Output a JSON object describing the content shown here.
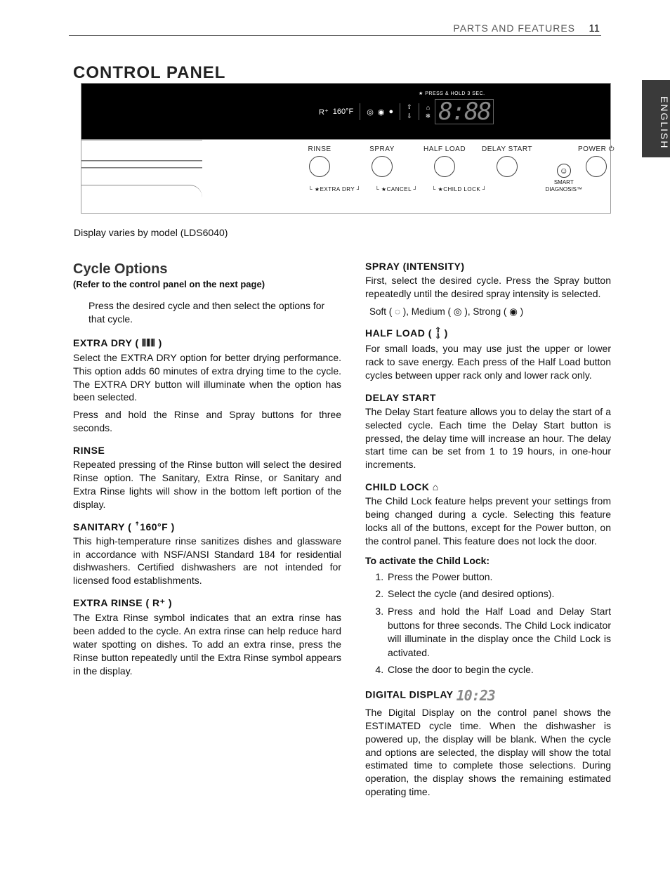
{
  "header": {
    "section": "PARTS AND FEATURES",
    "page": "11",
    "lang_tab": "ENGLISH"
  },
  "title": "CONTROL PANEL",
  "panel": {
    "press_hold": "PRESS & HOLD 3 SEC.",
    "display_icons": {
      "r": "R⁺",
      "temp": "160°F",
      "spray1": "◎",
      "spray2": "◉",
      "spray3": "●",
      "up": "⇧",
      "down": "⇩",
      "lock": "⌂",
      "snow": "❄"
    },
    "seg_display": "8:88",
    "buttons": {
      "rinse": "RINSE",
      "spray": "SPRAY",
      "half_load": "HALF LOAD",
      "delay_start": "DELAY START",
      "power": "POWER ⏻"
    },
    "under": {
      "extra_dry": "EXTRA DRY",
      "cancel": "CANCEL",
      "child_lock": "CHILD LOCK"
    },
    "smart_diag": {
      "label1": "SMART",
      "label2": "DIAGNOSIS™"
    }
  },
  "caption": "Display varies by model (LDS6040)",
  "left": {
    "cycle_heading": "Cycle Options",
    "refer": "(Refer to the control panel on the next page)",
    "intro": "Press the desired cycle and then select the options for that cycle.",
    "extra_dry": {
      "h": "EXTRA DRY ( ⫴⫴⫴ )",
      "p1": "Select the EXTRA DRY option for better drying performance. This option adds 60 minutes of extra drying time to the cycle. The EXTRA DRY button will illuminate when the option has been selected.",
      "p2": "Press and hold the Rinse and Spray buttons for three seconds."
    },
    "rinse": {
      "h": "RINSE",
      "p": "Repeated pressing of the Rinse button will select the desired Rinse option. The Sanitary, Extra Rinse, or Sanitary and Extra Rinse lights will show in the bottom left portion of the display."
    },
    "sanitary": {
      "h": "SANITARY ( ꜛ160°F )",
      "p": "This high-temperature rinse sanitizes dishes and glassware in accordance with NSF/ANSI Standard 184 for residential dishwashers. Certified dishwashers are not intended for licensed food establishments."
    },
    "extra_rinse": {
      "h": "EXTRA RINSE (  R⁺  )",
      "p": "The Extra Rinse symbol indicates that an extra rinse has been added to the cycle. An extra rinse can help reduce hard water spotting on dishes. To add an extra rinse, press the Rinse button repeatedly until the Extra Rinse symbol appears in the display."
    }
  },
  "right": {
    "spray": {
      "h": "SPRAY (INTENSITY)",
      "p": "First, select the desired cycle. Press the Spray button repeatedly until the desired spray intensity is selected.",
      "opts": "Soft (  ◌  ),   Medium (  ◎  ),   Strong (  ◉  )"
    },
    "half_load": {
      "h_pre": "HALF LOAD ( ",
      "h_post": " )",
      "p": "For small loads, you may use just the upper or lower rack to save energy. Each press of the Half Load button cycles between upper rack only and lower rack only."
    },
    "delay": {
      "h": "DELAY START",
      "p": "The Delay Start feature allows you to delay the start of a selected cycle. Each time the Delay Start button is pressed, the delay time will increase an hour. The delay start time can be set from 1 to 19 hours, in one-hour increments."
    },
    "child_lock": {
      "h": "CHILD LOCK  ⌂",
      "p": "The Child Lock feature helps prevent your settings from being changed during a cycle. Selecting this feature locks all of the buttons, except for the Power button, on the control panel. This feature does not lock the door.",
      "activate": "To activate the Child Lock:",
      "steps": [
        "Press the Power button.",
        "Select the cycle (and desired options).",
        "Press and hold the Half Load and Delay Start buttons for three seconds. The Child Lock indicator will illuminate in the display once the Child Lock is activated.",
        "Close the door to begin the cycle."
      ]
    },
    "digital": {
      "h_pre": "DIGITAL DISPLAY ",
      "icon": "10:23",
      "p": "The Digital Display on the control panel shows the ESTIMATED cycle time. When the dishwasher is powered up, the display will be blank. When the cycle and options are selected, the display will show the total estimated time to complete those selections. During operation, the display shows the remaining estimated operating time."
    }
  }
}
